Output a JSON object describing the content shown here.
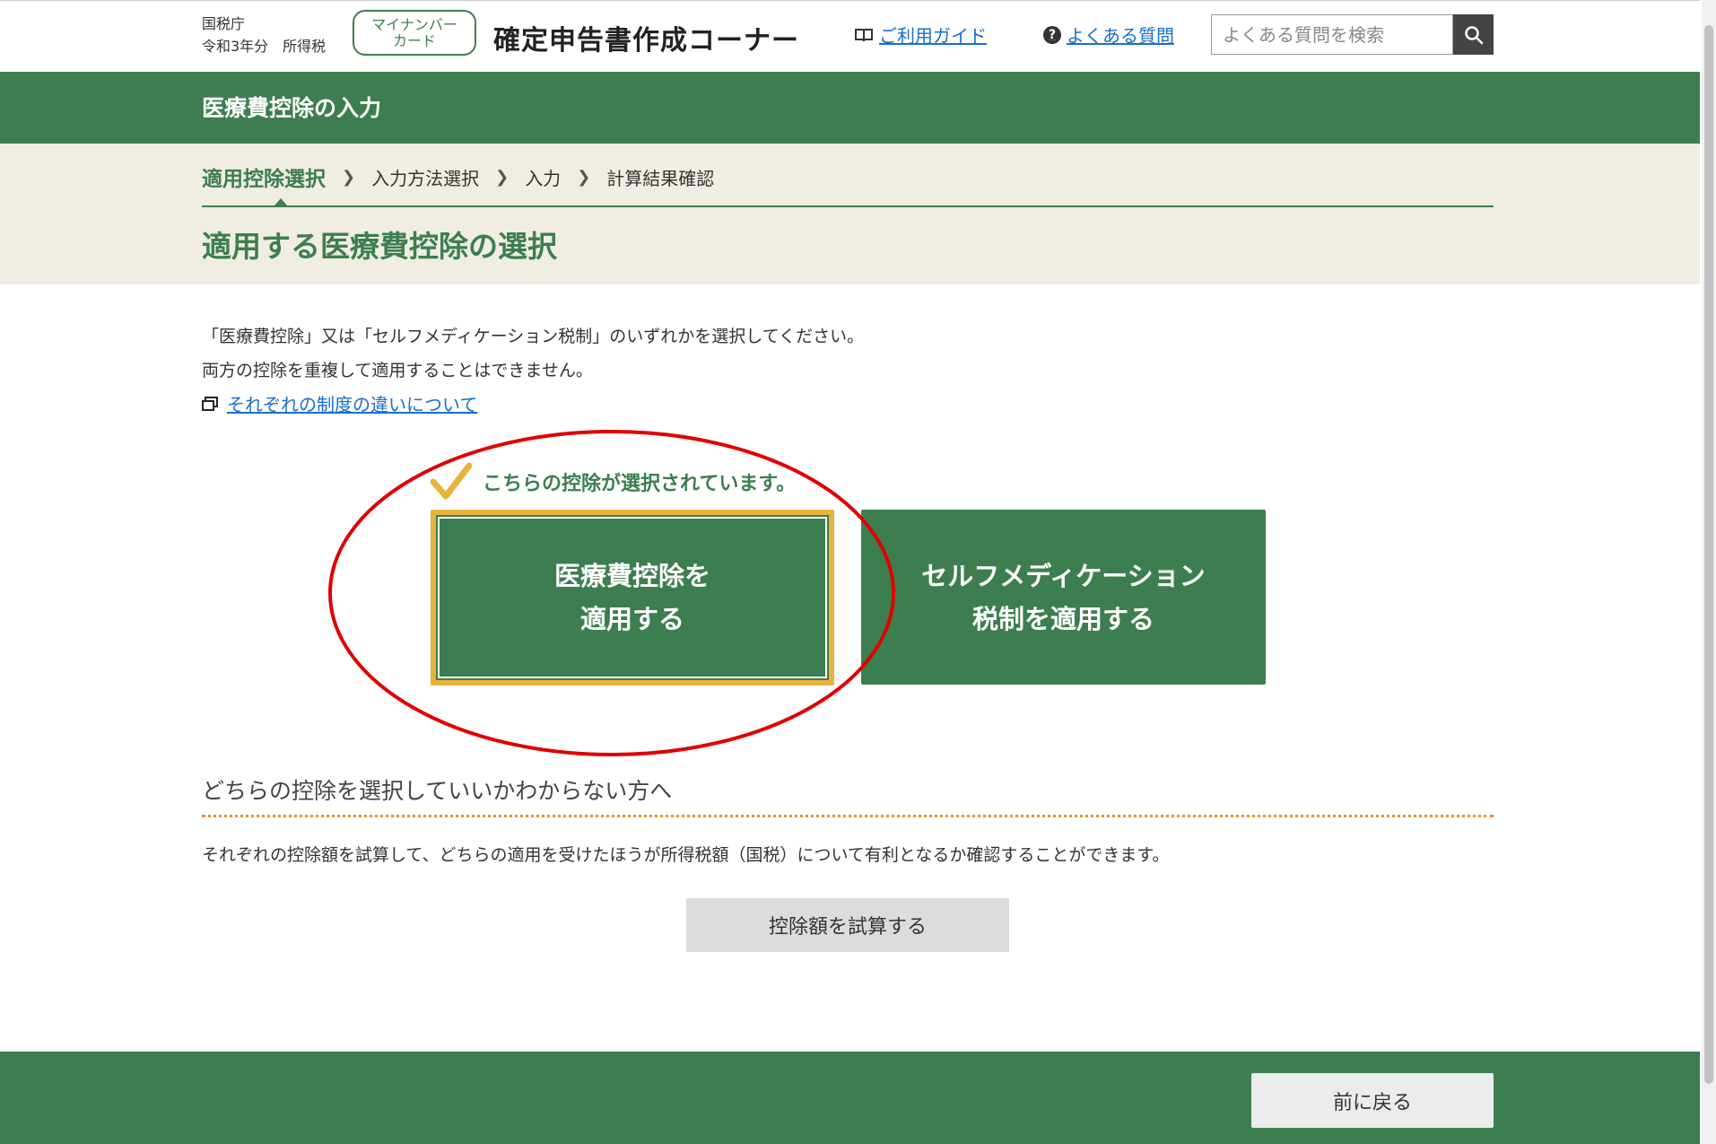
{
  "header": {
    "agency": "国税庁",
    "year_tax": "令和3年分　所得税",
    "mynumber_line1": "マイナンバー",
    "mynumber_line2": "カード",
    "site_title": "確定申告書作成コーナー",
    "guide_link": "ご利用ガイド",
    "faq_link": "よくある質問",
    "search_placeholder": "よくある質問を検索"
  },
  "section_title": "医療費控除の入力",
  "steps": [
    "適用控除選択",
    "入力方法選択",
    "入力",
    "計算結果確認"
  ],
  "page_title": "適用する医療費控除の選択",
  "intro": {
    "line1": "「医療費控除」又は「セルフメディケーション税制」のいずれかを選択してください。",
    "line2": "両方の控除を重複して適用することはできません。",
    "link": "それぞれの制度の違いについて"
  },
  "selection": {
    "selected_note": "こちらの控除が選択されています。",
    "medical_line1": "医療費控除を",
    "medical_line2": "適用する",
    "selfmed_line1": "セルフメディケーション",
    "selfmed_line2": "税制を適用する"
  },
  "help": {
    "heading": "どちらの控除を選択していいかわからない方へ",
    "text": "それぞれの控除額を試算して、どちらの適用を受けたほうが所得税額（国税）について有利となるか確認することができます。",
    "trial_button": "控除額を試算する"
  },
  "footer": {
    "back_button": "前に戻る"
  },
  "colors": {
    "brand_green": "#3d7e50",
    "selected_border": "#e8b33c",
    "annotation_red": "#e00000",
    "link_blue": "#1a6fc9"
  },
  "icons": {
    "guide": "book-icon",
    "faq": "question-circle-icon",
    "search": "search-icon",
    "link": "new-window-icon",
    "selected": "checkmark-icon"
  }
}
